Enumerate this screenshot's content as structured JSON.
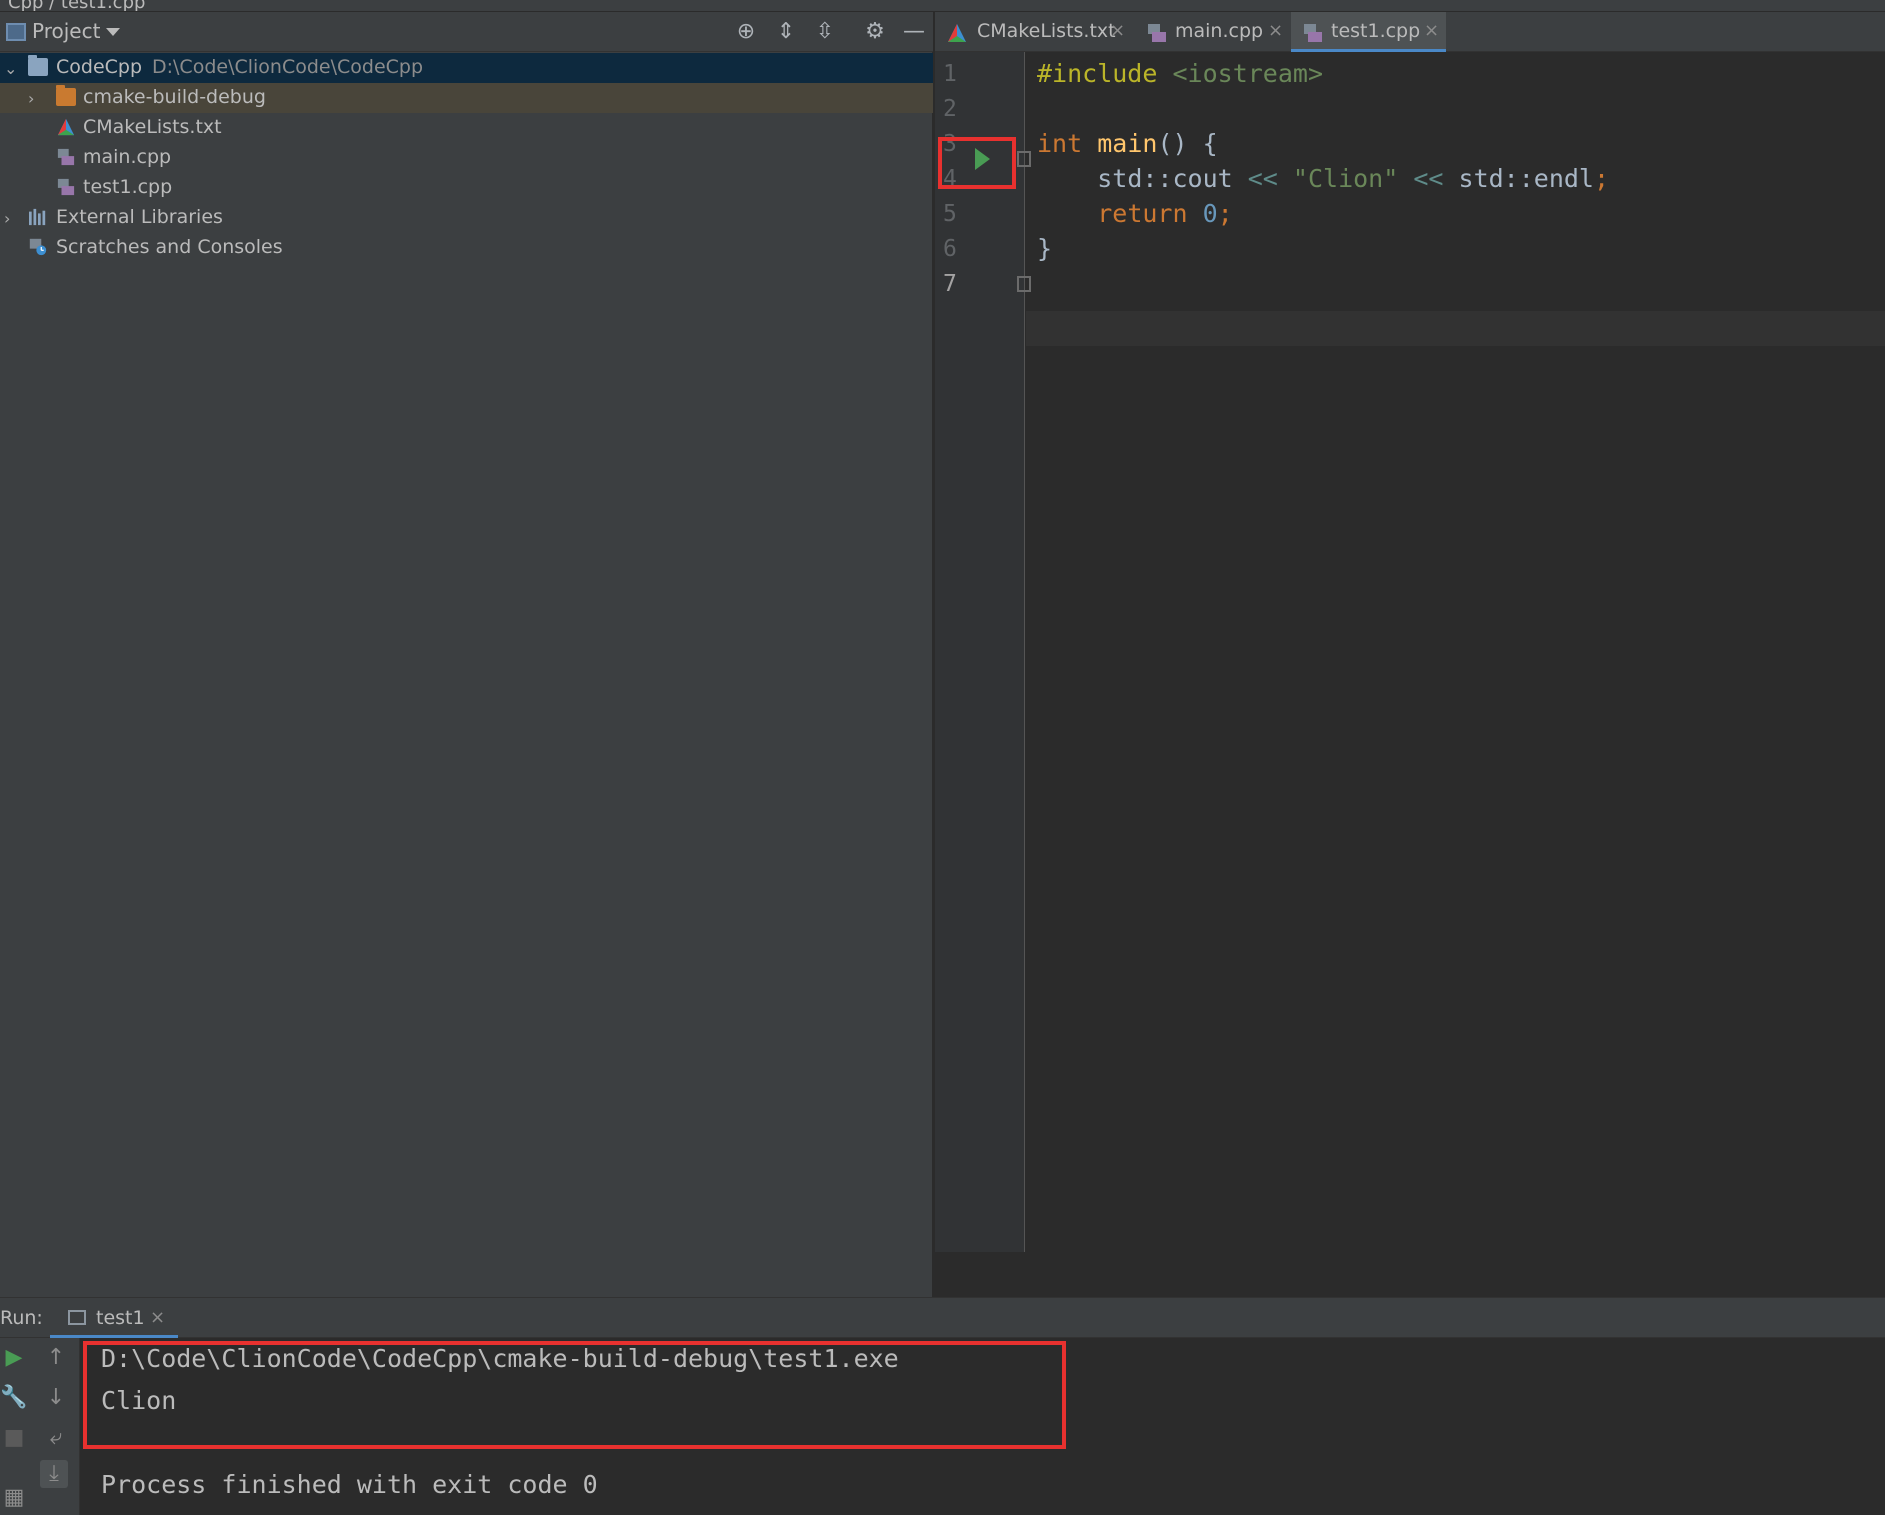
{
  "breadcrumb": {
    "text": "Cpp / test1.cpp"
  },
  "project_panel": {
    "title": "Project",
    "tree": [
      {
        "label": "CodeCpp",
        "path": "D:\\Code\\ClionCode\\CodeCpp"
      },
      {
        "label": "cmake-build-debug"
      },
      {
        "label": "CMakeLists.txt"
      },
      {
        "label": "main.cpp"
      },
      {
        "label": "test1.cpp"
      },
      {
        "label": "External Libraries"
      },
      {
        "label": "Scratches and Consoles"
      }
    ]
  },
  "editor": {
    "tabs": [
      {
        "label": "CMakeLists.txt"
      },
      {
        "label": "main.cpp"
      },
      {
        "label": "test1.cpp",
        "active": true
      }
    ],
    "line_numbers": [
      "1",
      "2",
      "3",
      "4",
      "5",
      "6",
      "7"
    ],
    "code": {
      "l1_pre": "#include",
      "l1_inc": "<iostream>",
      "l3_kw": "int",
      "l3_fn": "main",
      "l3_rest": "() {",
      "l4_a": "std::cout",
      "l4_op1": "<<",
      "l4_str": "\"Clion\"",
      "l4_op2": "<<",
      "l4_b": "std::endl",
      "l4_semi": ";",
      "l5_kw": "return",
      "l5_num": "0",
      "l5_semi": ";",
      "l6": "}"
    }
  },
  "run_panel": {
    "label": "Run:",
    "tab": "test1",
    "console": [
      "D:\\Code\\ClionCode\\CodeCpp\\cmake-build-debug\\test1.exe",
      "Clion",
      "",
      "Process finished with exit code 0"
    ]
  },
  "colors": {
    "highlight_box": "#e8312f",
    "selection": "#0d293e",
    "accent": "#4a88c7"
  }
}
